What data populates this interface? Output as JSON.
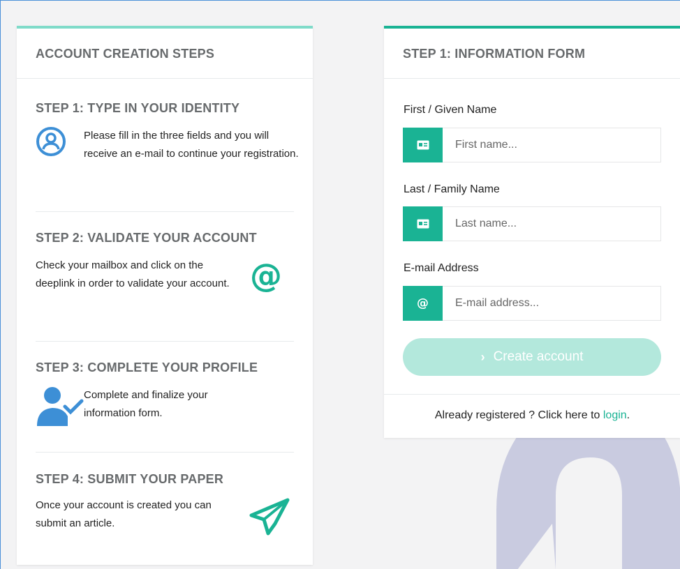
{
  "steps_panel": {
    "header": "ACCOUNT CREATION STEPS",
    "steps": [
      {
        "title": "STEP 1: TYPE IN YOUR IDENTITY",
        "text": "Please fill in the three fields and you will receive an e-mail to continue your registration.",
        "icon": "user-circle-icon"
      },
      {
        "title": "STEP 2: VALIDATE YOUR ACCOUNT",
        "text": "Check your mailbox and click on the deeplink in order to validate your account.",
        "icon": "at-sign-icon"
      },
      {
        "title": "STEP 3: COMPLETE YOUR PROFILE",
        "text": "Complete and finalize your information form.",
        "icon": "user-check-icon"
      },
      {
        "title": "STEP 4: SUBMIT YOUR PAPER",
        "text": "Once your account is created you can submit an article.",
        "icon": "paper-plane-icon"
      }
    ]
  },
  "form_panel": {
    "header": "STEP 1: INFORMATION FORM",
    "first_name": {
      "label": "First / Given Name",
      "placeholder": "First name...",
      "value": "",
      "icon": "id-card-icon"
    },
    "last_name": {
      "label": "Last / Family Name",
      "placeholder": "Last name...",
      "value": "",
      "icon": "id-card-icon"
    },
    "email": {
      "label": "E-mail Address",
      "placeholder": "E-mail address...",
      "value": "",
      "icon": "at-sign-icon"
    },
    "submit_label": "Create account",
    "footer_prefix": "Already registered ? Click here to ",
    "footer_link": "login",
    "footer_suffix": "."
  },
  "colors": {
    "accent": "#1ab394",
    "accent_light": "#7fdbc9",
    "button_disabled": "#b3e8dc",
    "step_icon_blue": "#3d8fd6",
    "background_logo": "#c5c7dd"
  }
}
